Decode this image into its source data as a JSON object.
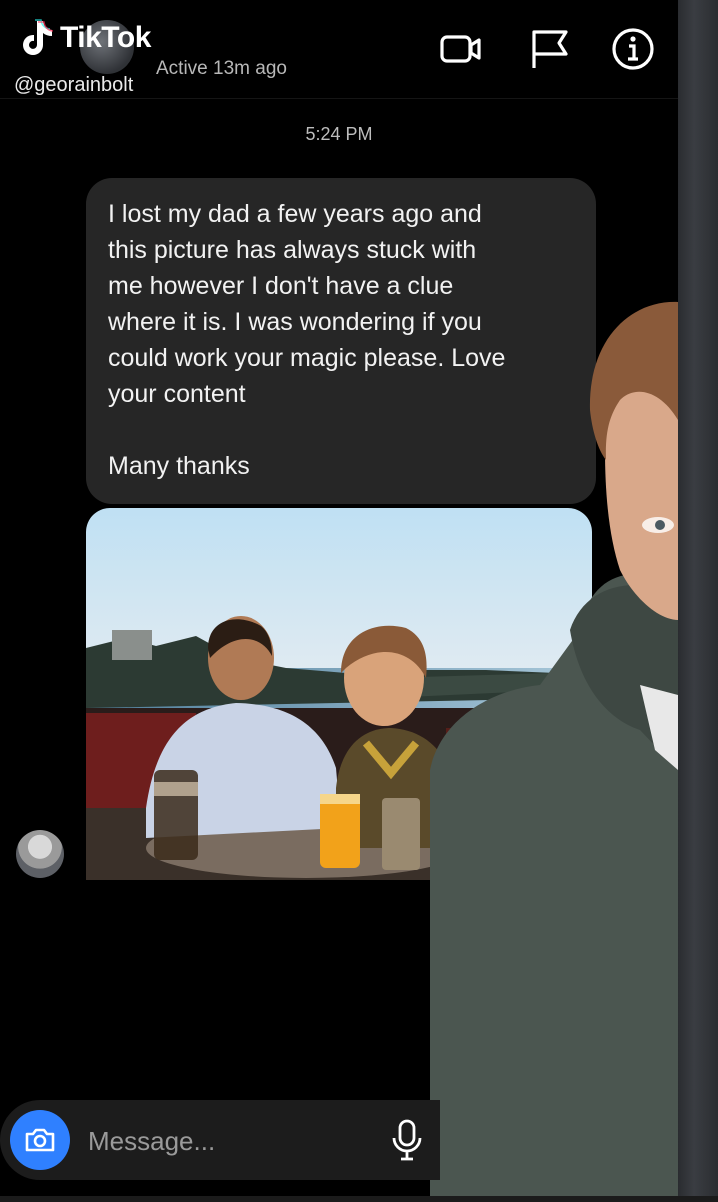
{
  "header": {
    "brand": "TikTok",
    "username": "@georainbolt",
    "active_status": "Active 13m ago"
  },
  "timestamp": "5:24 PM",
  "message": {
    "text": "I lost my dad a few years ago and\nthis picture has always stuck with\nme however I don't have a clue\nwhere it is. I was wondering if you\ncould work your magic please. Love\nyour content\n\nMany thanks"
  },
  "composer": {
    "placeholder": "Message..."
  },
  "colors": {
    "accent": "#2f80ff",
    "bubble": "#262626",
    "background": "#000000"
  },
  "icons": {
    "video": "video-call-icon",
    "flag": "flag-icon",
    "info": "info-icon",
    "camera": "camera-icon",
    "mic": "microphone-icon"
  }
}
